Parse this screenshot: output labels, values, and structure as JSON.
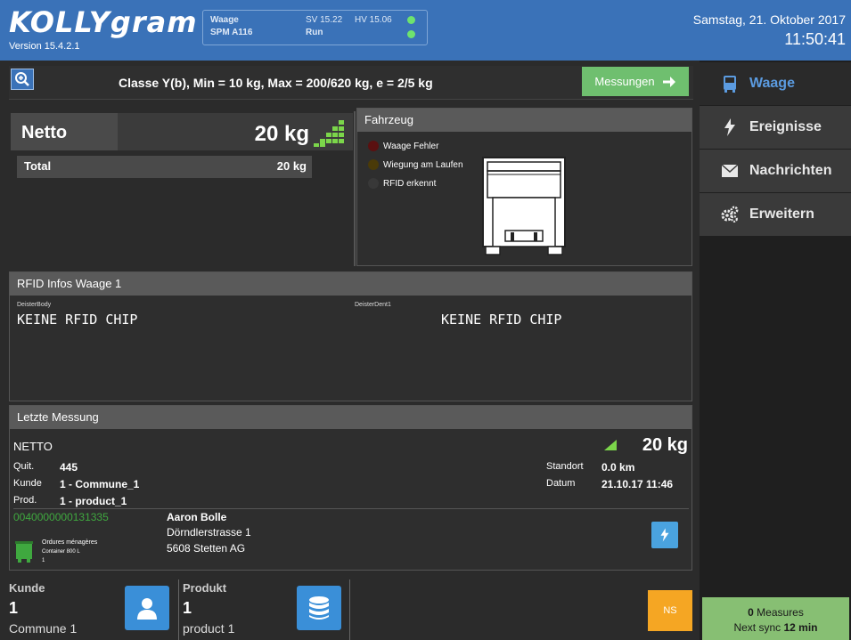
{
  "header": {
    "logo": "KOLLYgram",
    "version": "Version 15.4.2.1",
    "status": {
      "device_label": "Waage",
      "device_id": "SPM A116",
      "sv_label": "SV 15.22",
      "hv_label": "HV 15.06",
      "run_label": "Run"
    },
    "date": "Samstag, 21. Oktober 2017",
    "time": "11:50:41"
  },
  "classbar": {
    "class_text": "Classe Y(b), Min = 10 kg, Max = 200/620 kg, e = 2/5 kg",
    "messungen_label": "Messungen"
  },
  "sidebar": {
    "items": [
      {
        "label": "Waage",
        "icon": "bus-icon",
        "active": true
      },
      {
        "label": "Ereignisse",
        "icon": "lightning-icon",
        "active": false
      },
      {
        "label": "Nachrichten",
        "icon": "envelope-icon",
        "active": false
      },
      {
        "label": "Erweitern",
        "icon": "gears-icon",
        "active": false
      }
    ],
    "sync": {
      "measures_count": "0",
      "measures_label": "Measures",
      "next_sync_label": "Next sync",
      "next_sync_value": "12 min"
    }
  },
  "weight": {
    "netto_label": "Netto",
    "netto_value": "20 kg",
    "total_label": "Total",
    "total_value": "20 kg"
  },
  "fahrzeug": {
    "title": "Fahrzeug",
    "legend": [
      {
        "label": "Waage Fehler",
        "color": "#5a1010"
      },
      {
        "label": "Wiegung am Laufen",
        "color": "#4a3a08"
      },
      {
        "label": "RFID erkennt",
        "color": "#383838"
      }
    ]
  },
  "rfid": {
    "title": "RFID Infos Waage 1",
    "left_small": "DeisterBody",
    "left_value": "KEINE RFID CHIP",
    "right_small": "DeisterDent1",
    "right_value": "KEINE RFID CHIP"
  },
  "letzte": {
    "title": "Letzte Messung",
    "type": "NETTO",
    "weight": "20 kg",
    "quit_label": "Quit.",
    "quit_value": "445",
    "kunde_label": "Kunde",
    "kunde_value": "1 - Commune_1",
    "prod_label": "Prod.",
    "prod_value": "1 - product_1",
    "standort_label": "Standort",
    "standort_value": "0.0 km",
    "datum_label": "Datum",
    "datum_value": "21.10.17 11:46",
    "rfid_code": "0040000000131335",
    "container_line1": "Ordures ménagères",
    "container_line2": "Container 800 L",
    "container_line3": "1",
    "person_name": "Aaron Bolle",
    "street": "Dörndlerstrasse 1",
    "city": "5608 Stetten AG"
  },
  "bottom": {
    "kunde_title": "Kunde",
    "kunde_num": "1",
    "kunde_name": "Commune 1",
    "produkt_title": "Produkt",
    "produkt_num": "1",
    "produkt_name": "product 1",
    "ns_label": "NS"
  },
  "colors": {
    "header_blue": "#3a72b8",
    "accent_green": "#6fbf6f",
    "sync_green": "#87bf73",
    "ns_orange": "#f5a623",
    "rfid_code_green": "#3fa83f"
  }
}
